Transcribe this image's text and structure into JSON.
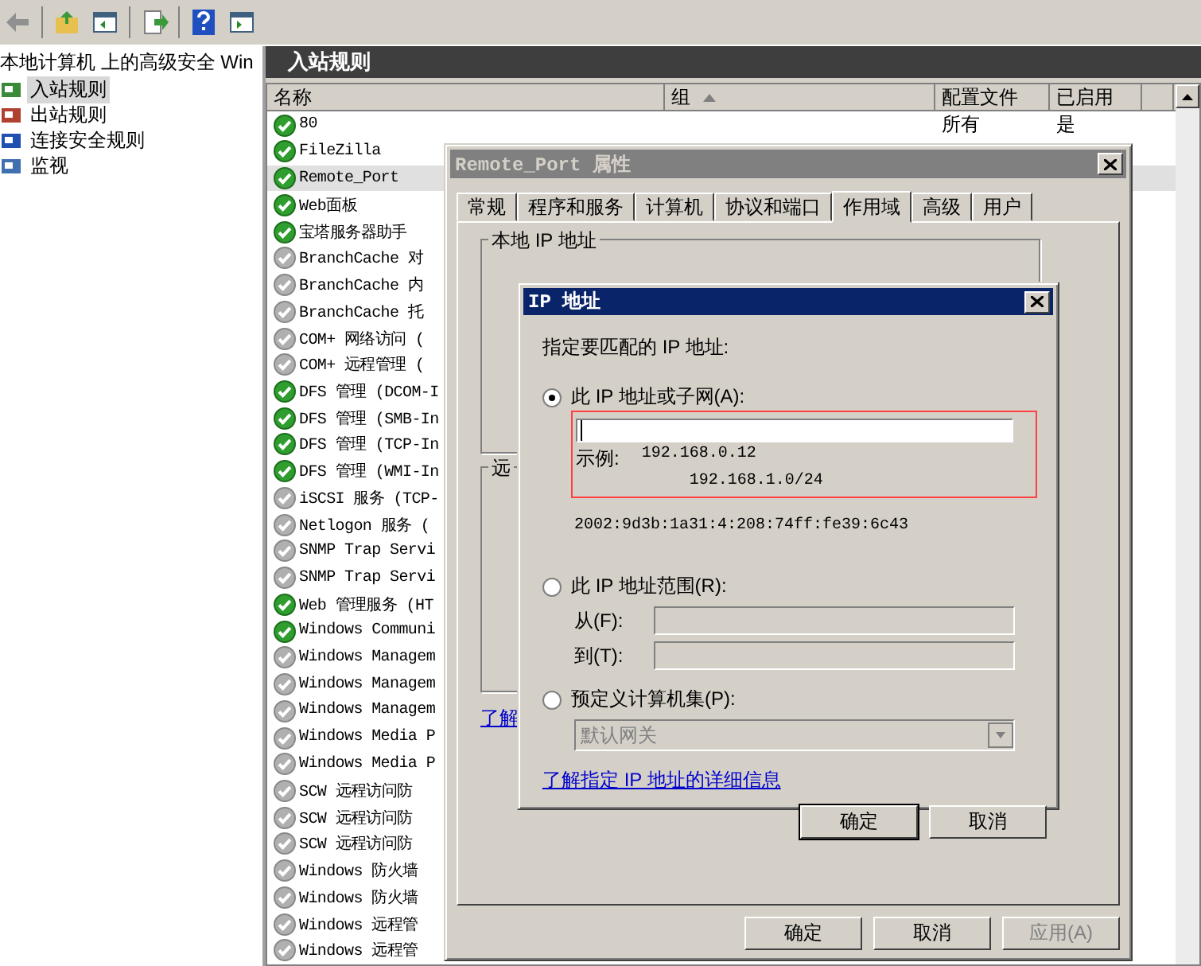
{
  "tree": {
    "title": "本地计算机 上的高级安全 Win",
    "items": [
      {
        "label": "入站规则",
        "selected": true,
        "kind": "inbound"
      },
      {
        "label": "出站规则",
        "selected": false,
        "kind": "outbound"
      },
      {
        "label": "连接安全规则",
        "selected": false,
        "kind": "security"
      },
      {
        "label": "监视",
        "selected": false,
        "kind": "monitor"
      }
    ]
  },
  "pane": {
    "title": "入站规则",
    "columns": [
      "名称",
      "组",
      "配置文件",
      "已启用"
    ],
    "rows": [
      {
        "name": "80",
        "enabled": true,
        "selected": false,
        "profile": "所有",
        "on": "是"
      },
      {
        "name": "FileZilla",
        "enabled": true,
        "selected": false
      },
      {
        "name": "Remote_Port",
        "enabled": true,
        "selected": true
      },
      {
        "name": "Web面板",
        "enabled": true,
        "selected": false
      },
      {
        "name": "宝塔服务器助手",
        "enabled": true,
        "selected": false
      },
      {
        "name": "BranchCache 对",
        "enabled": false,
        "selected": false
      },
      {
        "name": "BranchCache 内",
        "enabled": false,
        "selected": false
      },
      {
        "name": "BranchCache 托",
        "enabled": false,
        "selected": false
      },
      {
        "name": "COM+ 网络访问 (",
        "enabled": false,
        "selected": false
      },
      {
        "name": "COM+ 远程管理 (",
        "enabled": false,
        "selected": false
      },
      {
        "name": "DFS 管理 (DCOM-I",
        "enabled": true,
        "selected": false
      },
      {
        "name": "DFS 管理 (SMB-In",
        "enabled": true,
        "selected": false
      },
      {
        "name": "DFS 管理 (TCP-In",
        "enabled": true,
        "selected": false
      },
      {
        "name": "DFS 管理 (WMI-In",
        "enabled": true,
        "selected": false
      },
      {
        "name": "iSCSI 服务 (TCP-",
        "enabled": false,
        "selected": false
      },
      {
        "name": "Netlogon 服务 (",
        "enabled": false,
        "selected": false
      },
      {
        "name": "SNMP Trap Servi",
        "enabled": false,
        "selected": false
      },
      {
        "name": "SNMP Trap Servi",
        "enabled": false,
        "selected": false
      },
      {
        "name": "Web 管理服务 (HT",
        "enabled": true,
        "selected": false
      },
      {
        "name": "Windows Communi",
        "enabled": true,
        "selected": false
      },
      {
        "name": "Windows Managem",
        "enabled": false,
        "selected": false
      },
      {
        "name": "Windows Managem",
        "enabled": false,
        "selected": false
      },
      {
        "name": "Windows Managem",
        "enabled": false,
        "selected": false
      },
      {
        "name": "Windows Media P",
        "enabled": false,
        "selected": false
      },
      {
        "name": "Windows Media P",
        "enabled": false,
        "selected": false
      },
      {
        "name": "SCW 远程访问防",
        "enabled": false,
        "selected": false
      },
      {
        "name": "SCW 远程访问防",
        "enabled": false,
        "selected": false
      },
      {
        "name": "SCW 远程访问防",
        "enabled": false,
        "selected": false
      },
      {
        "name": "Windows 防火墙",
        "enabled": false,
        "selected": false
      },
      {
        "name": "Windows 防火墙",
        "enabled": false,
        "selected": false
      },
      {
        "name": "Windows 远程管",
        "enabled": false,
        "selected": false
      },
      {
        "name": "Windows 远程管",
        "enabled": false,
        "selected": false
      }
    ]
  },
  "properties": {
    "title": "Remote_Port 属性",
    "tabs": [
      {
        "label": "常规",
        "selected": false
      },
      {
        "label": "程序和服务",
        "selected": false
      },
      {
        "label": "计算机",
        "selected": false
      },
      {
        "label": "协议和端口",
        "selected": false
      },
      {
        "label": "作用域",
        "selected": true
      },
      {
        "label": "高级",
        "selected": false
      },
      {
        "label": "用户",
        "selected": false
      }
    ],
    "groups": [
      "本地 IP 地址",
      "远"
    ],
    "link": "了解",
    "buttons": [
      {
        "label": "确定",
        "disabled": false
      },
      {
        "label": "取消",
        "disabled": false
      },
      {
        "label": "应用(A)",
        "disabled": true
      }
    ]
  },
  "ip_dialog": {
    "title": "IP 地址",
    "prompt": "指定要匹配的 IP 地址:",
    "options": [
      {
        "kind": "subnet",
        "label": "此 IP 地址或子网(A):",
        "selected": true,
        "example_label": "示例:",
        "examples": [
          "192.168.0.12",
          "192.168.1.0/24"
        ],
        "note": "2002:9d3b:1a31:4:208:74ff:fe39:6c43"
      },
      {
        "kind": "range",
        "label": "此 IP 地址范围(R):",
        "selected": false,
        "from_label": "从(F):",
        "to_label": "到(T):"
      },
      {
        "kind": "preset",
        "label": "预定义计算机集(P):",
        "selected": false,
        "value": "默认网关"
      }
    ],
    "link": "了解指定 IP 地址的详细信息",
    "buttons": [
      {
        "label": "确定",
        "default": true
      },
      {
        "label": "取消",
        "default": false
      }
    ]
  }
}
